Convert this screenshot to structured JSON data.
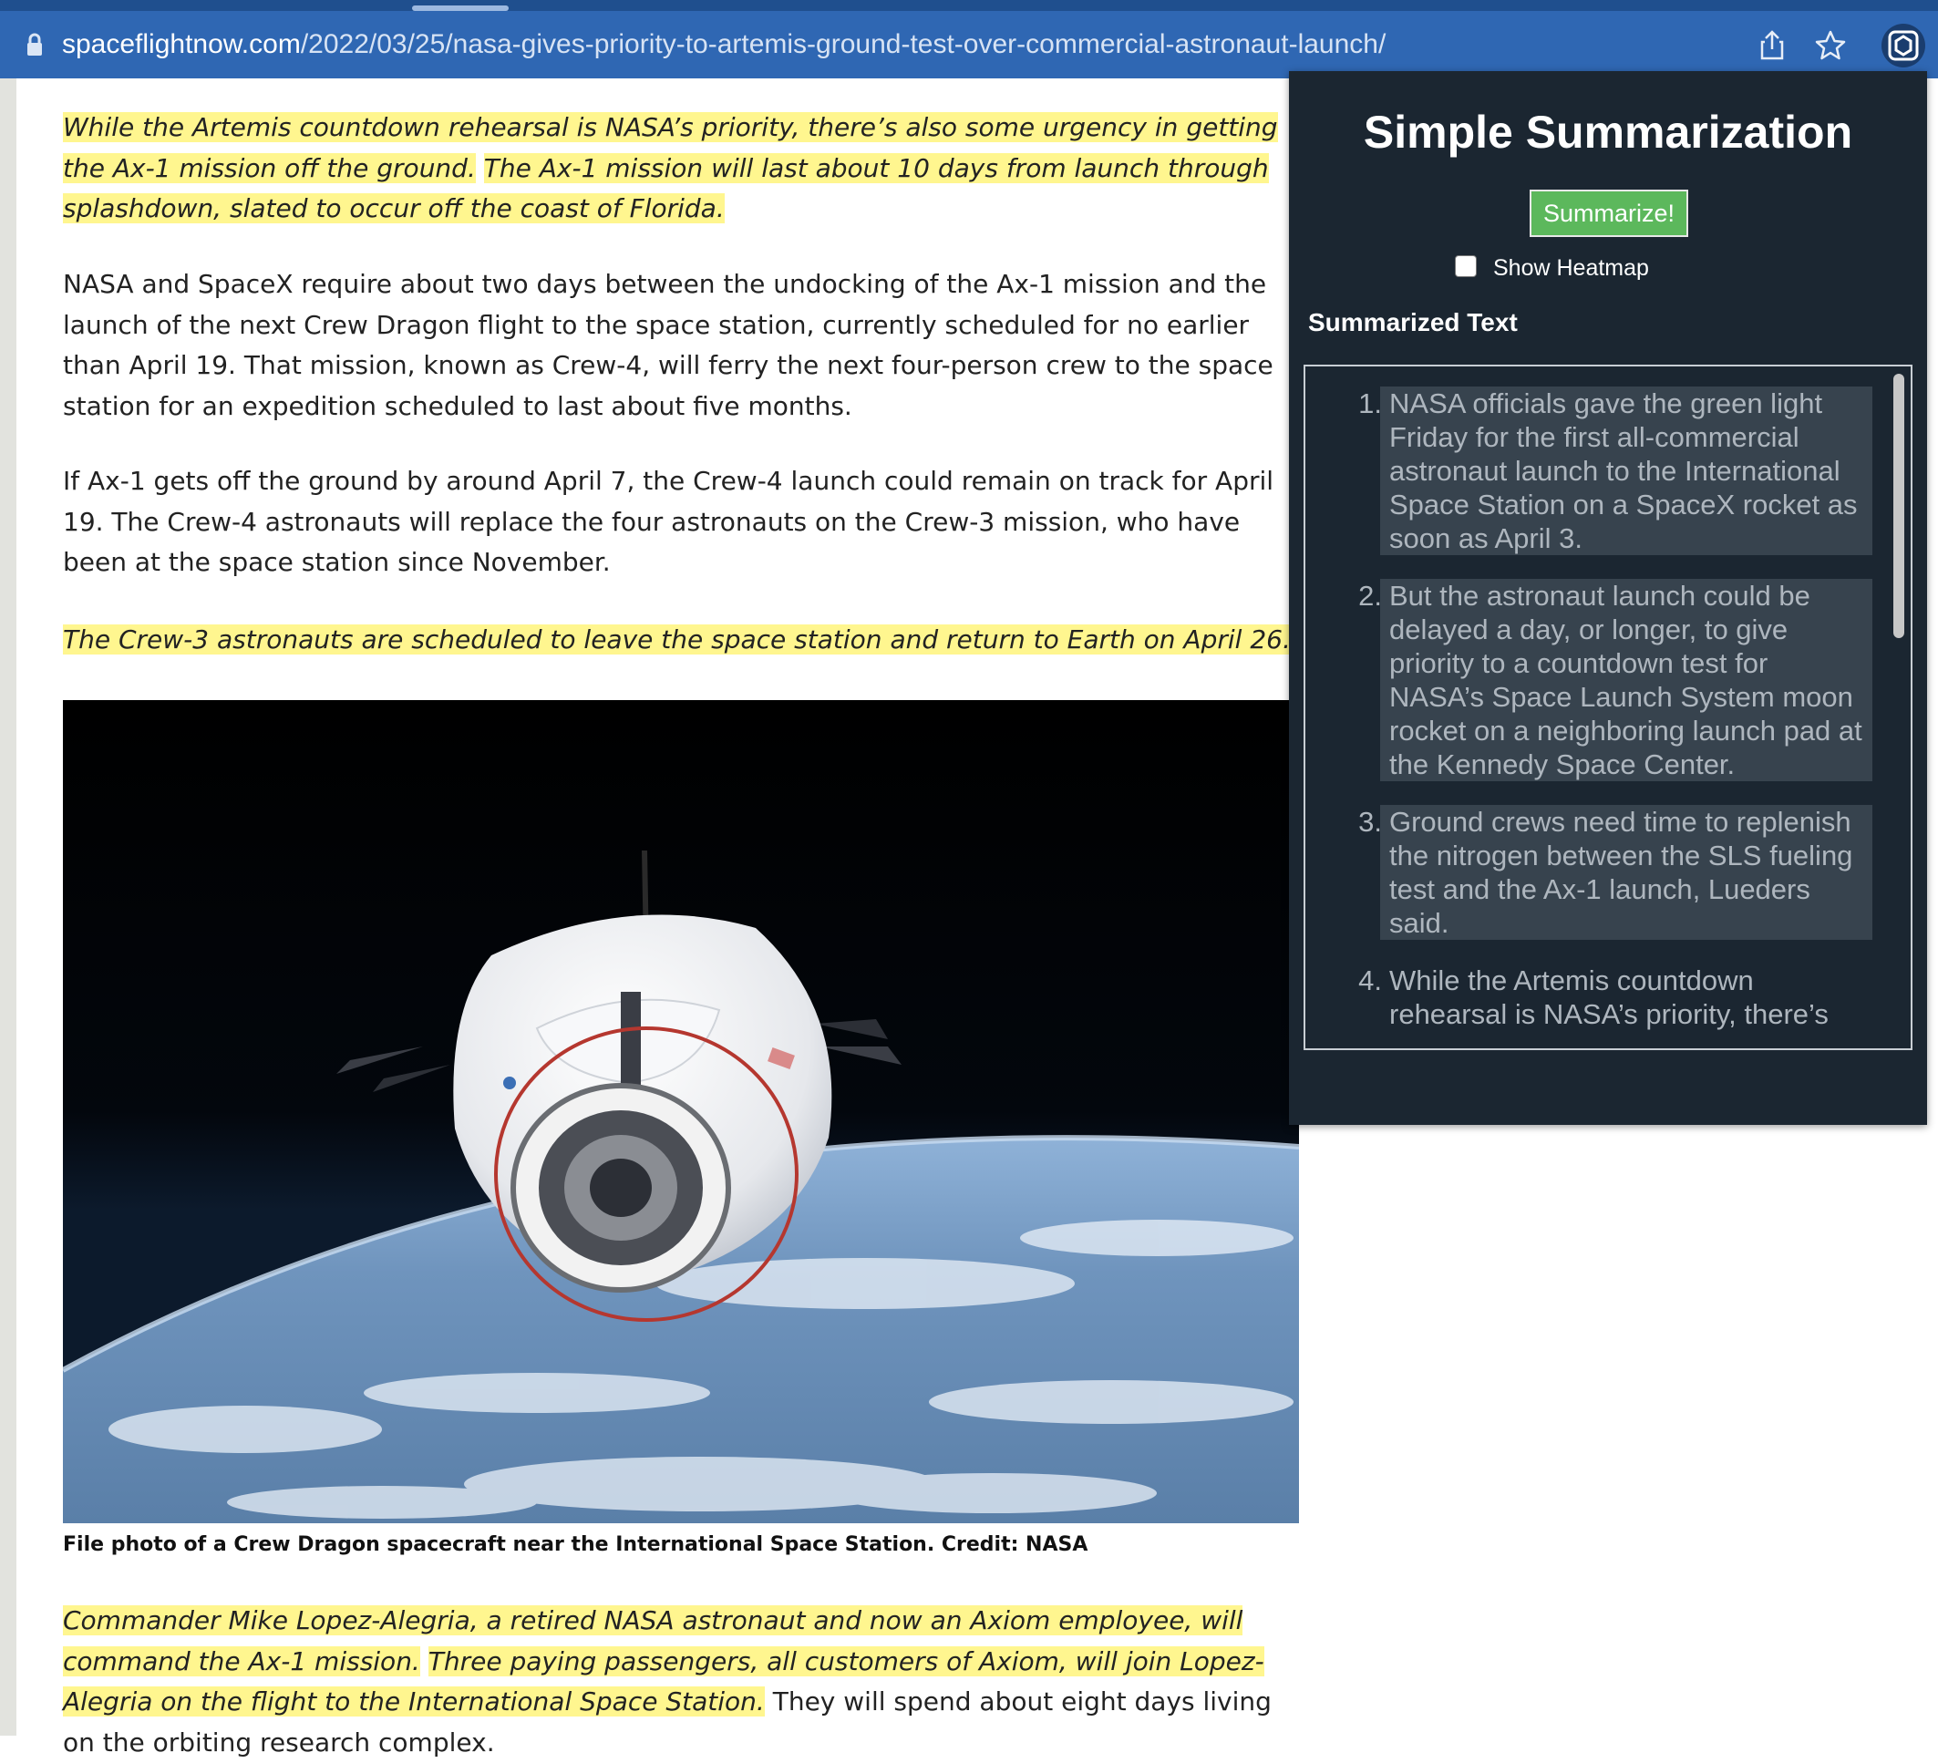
{
  "browser": {
    "url_host": "spaceflightnow.com",
    "url_path": "/2022/03/25/nasa-gives-priority-to-artemis-ground-test-over-commercial-astronaut-launch/",
    "icons": [
      "lock-icon",
      "share-icon",
      "bookmark-star-icon",
      "extension-icon"
    ]
  },
  "article": {
    "p1": {
      "hl1": "While the Artemis countdown rehearsal is NASA’s priority, there’s also some urgency in getting the Ax-1 mission off the ground.",
      "hl2": "The Ax-1 mission will last about 10 days from launch through splashdown, slated to occur off the coast of Florida."
    },
    "p2": "NASA and SpaceX require about two days between the undocking of the Ax-1 mission and the launch of the next Crew Dragon flight to the space station, currently scheduled for no earlier than April 19. That mission, known as Crew-4, will ferry the next four-person crew to the space station for an expedition scheduled to last about five months.",
    "p3": "If Ax-1 gets off the ground by around April 7, the Crew-4 launch could remain on track for April 19. The Crew-4 astronauts will replace the four astronauts on the Crew-3 mission, who have been at the space station since November.",
    "p4": {
      "hl": "The Crew-3 astronauts are scheduled to leave the space station and return to Earth on April 26."
    },
    "photo_caption": "File photo of a Crew Dragon spacecraft near the International Space Station. Credit: NASA",
    "p5": {
      "hl1": "Commander Mike Lopez-Alegria, a retired NASA astronaut and now an Axiom employee, will command the Ax-1 mission.",
      "hl2": "Three paying passengers, all customers of Axiom, will join Lopez-Alegria on the flight to the International Space Station.",
      "plain": "They will spend about eight days living on the orbiting research complex."
    }
  },
  "panel": {
    "title": "Simple Summarization",
    "summarize_label": "Summarize!",
    "heatmap_label": "Show Heatmap",
    "heatmap_checked": false,
    "summarized_header": "Summarized Text",
    "items": [
      {
        "num": "1.",
        "text": "NASA officials gave the green light Friday for the first all-commercial astronaut launch to the International Space Station on a SpaceX rocket as soon as April 3."
      },
      {
        "num": "2.",
        "text": "But the astronaut launch could be delayed a day, or longer, to give priority to a countdown test for NASA’s Space Launch System moon rocket on a neighboring launch pad at the Kennedy Space Center."
      },
      {
        "num": "3.",
        "text": "Ground crews need time to replenish the nitrogen between the SLS fueling test and the Ax-1 launch, Lueders said."
      },
      {
        "num": "4.",
        "text": "While the Artemis countdown rehearsal is NASA’s priority, there’s"
      }
    ]
  },
  "colors": {
    "toolbar": "#2f67b3",
    "highlight": "#fff68f",
    "panel_bg": "#1b2631",
    "button_green": "#5cb85c",
    "summary_text": "#aeb6be"
  }
}
